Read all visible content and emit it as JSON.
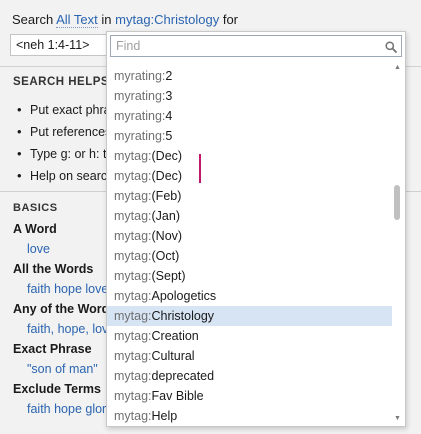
{
  "header": {
    "search_label": "Search",
    "scope_link": "All Text",
    "in_label": "in",
    "collection_link": "mytag:Christology",
    "for_label": "for"
  },
  "query": {
    "value": "<neh 1:4-11>"
  },
  "helps": {
    "title": "SEARCH HELPS",
    "items": [
      "Put exact phra",
      "Put references",
      "Type g: or h: t",
      "Help on searc"
    ]
  },
  "basics": {
    "title": "BASICS",
    "rows": [
      {
        "label": "A Word",
        "example": "love"
      },
      {
        "label": "All the Words",
        "example": "faith hope love"
      },
      {
        "label": "Any of the Words",
        "example": "faith, hope, lov"
      },
      {
        "label": "Exact Phrase",
        "example": "\"son of man\""
      },
      {
        "label": "Exclude Terms",
        "example": "faith hope glor"
      }
    ]
  },
  "popup": {
    "find_placeholder": "Find",
    "search_icon": "search-icon",
    "selected_index": 12,
    "items": [
      {
        "prefix": "myrating:",
        "value": "2"
      },
      {
        "prefix": "myrating:",
        "value": "3"
      },
      {
        "prefix": "myrating:",
        "value": "4"
      },
      {
        "prefix": "myrating:",
        "value": "5"
      },
      {
        "prefix": "mytag:",
        "value": "(Dec)"
      },
      {
        "prefix": "mytag:",
        "value": "(Dec)"
      },
      {
        "prefix": "mytag:",
        "value": "(Feb)"
      },
      {
        "prefix": "mytag:",
        "value": "(Jan)"
      },
      {
        "prefix": "mytag:",
        "value": "(Nov)"
      },
      {
        "prefix": "mytag:",
        "value": "(Oct)"
      },
      {
        "prefix": "mytag:",
        "value": "(Sept)"
      },
      {
        "prefix": "mytag:",
        "value": "Apologetics"
      },
      {
        "prefix": "mytag:",
        "value": "Christology"
      },
      {
        "prefix": "mytag:",
        "value": "Creation"
      },
      {
        "prefix": "mytag:",
        "value": "Cultural"
      },
      {
        "prefix": "mytag:",
        "value": "deprecated"
      },
      {
        "prefix": "mytag:",
        "value": "Fav Bible"
      },
      {
        "prefix": "mytag:",
        "value": "Help"
      }
    ]
  },
  "colors": {
    "link": "#2a64b0",
    "selected_row": "#d6e4f4",
    "cursor_mark": "#c2186b"
  }
}
